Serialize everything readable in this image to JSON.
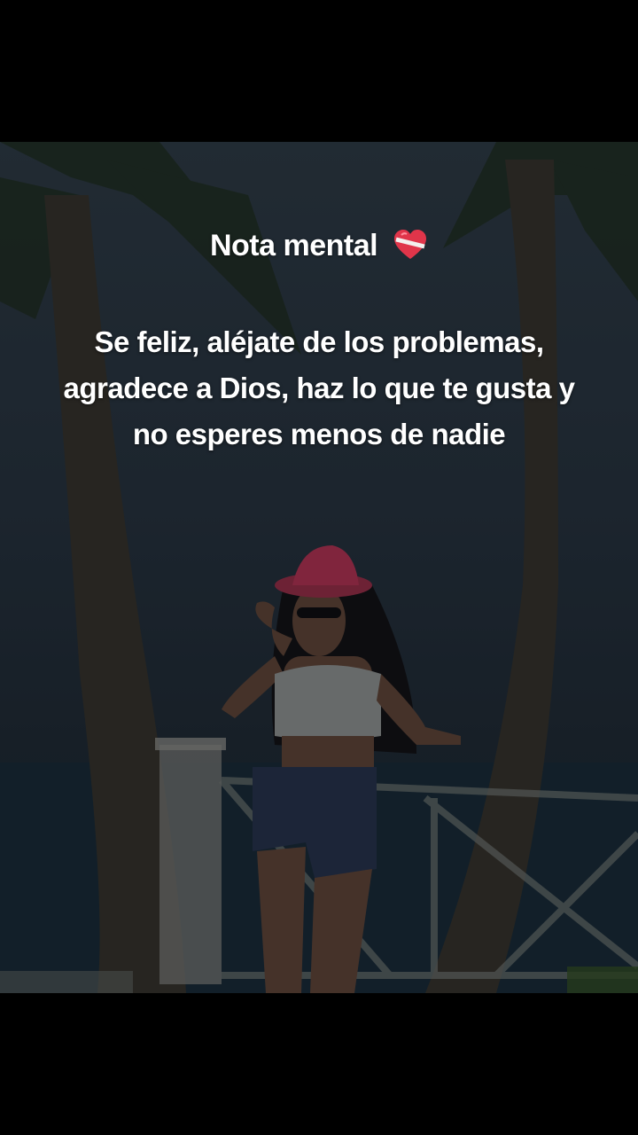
{
  "post": {
    "title": "Nota mental",
    "title_emoji": "mending-heart-emoji",
    "quote": "Se feliz, aléjate de los problemas, agradece a Dios, haz lo que te gusta y no esperes menos de nadie"
  },
  "colors": {
    "letterbox": "#000000",
    "text": "#ffffff",
    "heart": "#e0354a",
    "hat": "#c53a5e"
  }
}
